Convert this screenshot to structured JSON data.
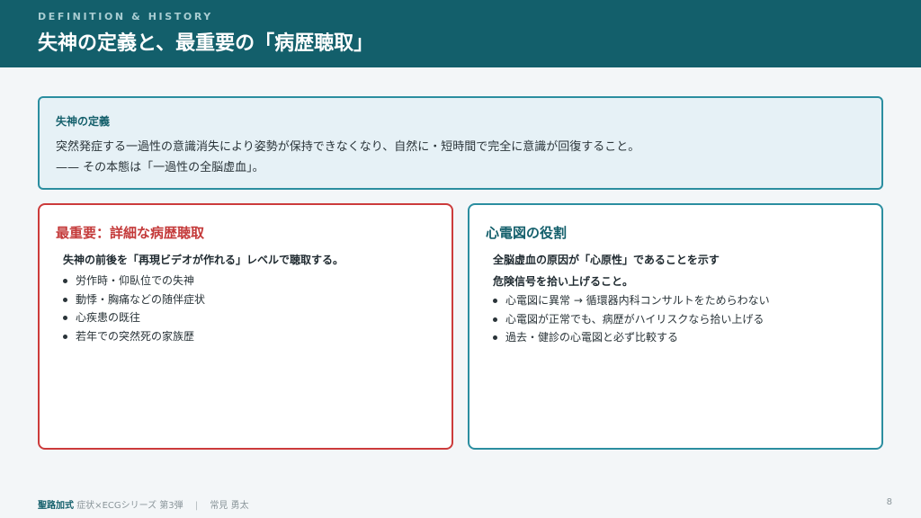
{
  "header": {
    "kicker": "DEFINITION & HISTORY",
    "title": "失神の定義と、最重要の「病歴聴取」"
  },
  "definition": {
    "label": "失神の定義",
    "line1": "突然発症する一過性の意識消失により姿勢が保持できなくなり、自然に・短時間で完全に意識が回復すること。",
    "line2": "—— その本態は「一過性の全脳虚血」。"
  },
  "left_card": {
    "title": "最重要：詳細な病歴聴取",
    "subtitle": "失神の前後を「再現ビデオが作れる」レベルで聴取する。",
    "bullets": [
      "労作時・仰臥位での失神",
      "動悸・胸痛などの随伴症状",
      "心疾患の既往",
      "若年での突然死の家族歴"
    ]
  },
  "right_card": {
    "title": "心電図の役割",
    "subtitle1": "全脳虚血の原因が「心原性」であることを示す",
    "subtitle2": "危険信号を拾い上げること。",
    "bullets": [
      "心電図に異常 → 循環器内科コンサルトをためらわない",
      "心電図が正常でも、病歴がハイリスクなら拾い上げる",
      "過去・健診の心電図と必ず比較する"
    ]
  },
  "footer": {
    "brand": "聖路加式",
    "series": "症状×ECGシリーズ 第3弾",
    "separator": "|",
    "author": "常見 勇太",
    "page": "8"
  },
  "colors": {
    "header_bg": "#135f6b",
    "accent_red": "#cc3b3b",
    "accent_teal": "#2b8ea0",
    "definition_bg": "#e6f1f6"
  }
}
